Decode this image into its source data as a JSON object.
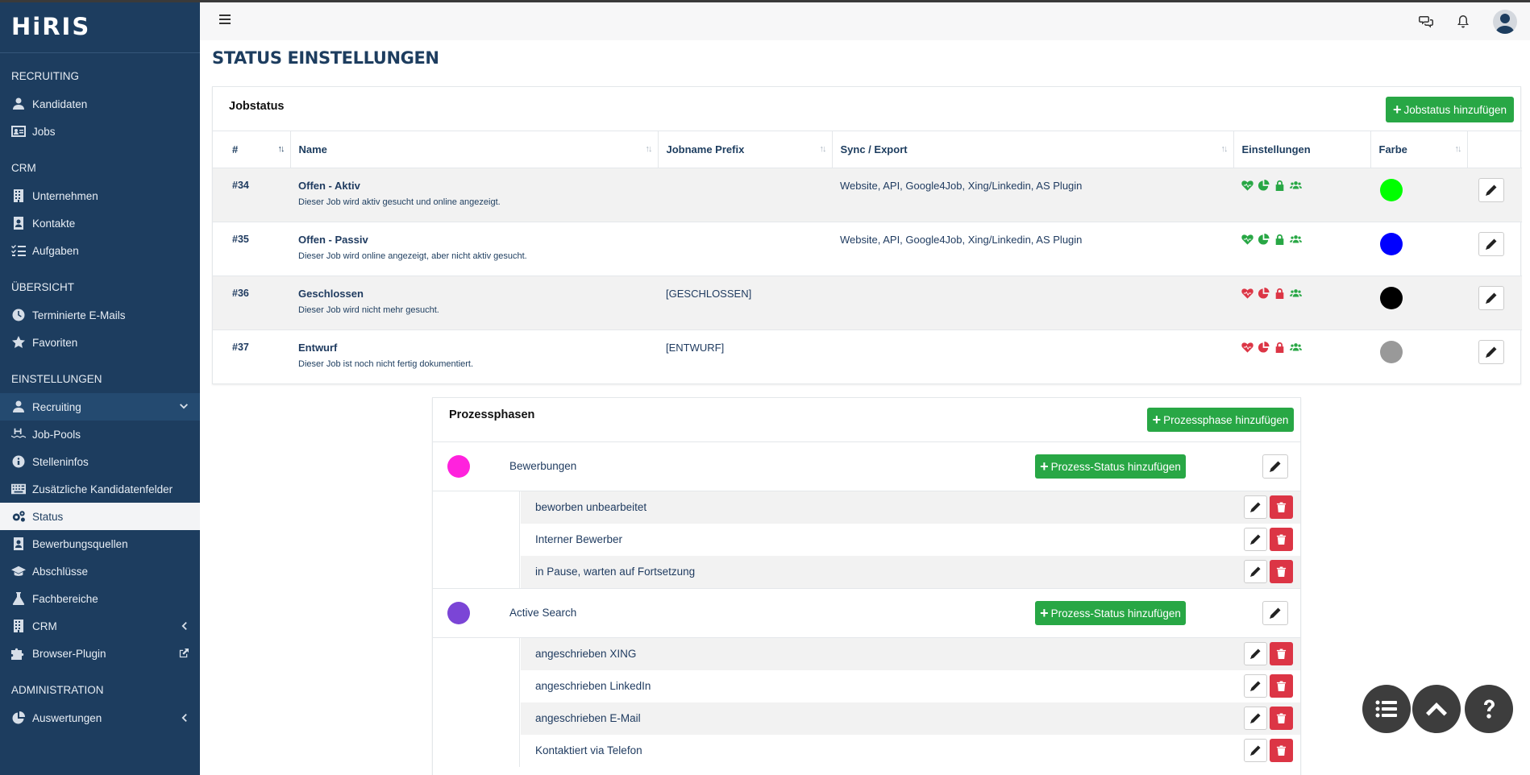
{
  "app": {
    "logo": "HiRIS"
  },
  "sidebar": {
    "sections": [
      {
        "title": "RECRUITING",
        "items": [
          {
            "label": "Kandidaten"
          },
          {
            "label": "Jobs"
          }
        ]
      },
      {
        "title": "CRM",
        "items": [
          {
            "label": "Unternehmen"
          },
          {
            "label": "Kontakte"
          },
          {
            "label": "Aufgaben"
          }
        ]
      },
      {
        "title": "ÜBERSICHT",
        "items": [
          {
            "label": "Terminierte E-Mails"
          },
          {
            "label": "Favoriten"
          }
        ]
      },
      {
        "title": "EINSTELLUNGEN",
        "items": [
          {
            "label": "Recruiting"
          },
          {
            "label": "Job-Pools"
          },
          {
            "label": "Stelleninfos"
          },
          {
            "label": "Zusätzliche Kandidatenfelder"
          },
          {
            "label": "Status"
          },
          {
            "label": "Bewerbungsquellen"
          },
          {
            "label": "Abschlüsse"
          },
          {
            "label": "Fachbereiche"
          },
          {
            "label": "CRM"
          },
          {
            "label": "Browser-Plugin"
          }
        ]
      },
      {
        "title": "ADMINISTRATION",
        "items": [
          {
            "label": "Auswertungen"
          }
        ]
      }
    ]
  },
  "page": {
    "title": "STATUS EINSTELLUNGEN"
  },
  "jobstatus": {
    "title": "Jobstatus",
    "add_label": "Jobstatus hinzufügen",
    "columns": [
      "#",
      "Name",
      "Jobname Prefix",
      "Sync / Export",
      "Einstellungen",
      "Farbe"
    ],
    "rows": [
      {
        "id": "#34",
        "name": "Offen - Aktiv",
        "desc": "Dieser Job wird aktiv gesucht und online angezeigt.",
        "prefix": "",
        "sync": "Website, API, Google4Job, Xing/Linkedin, AS Plugin",
        "color": "#00ff00",
        "setting_color": "#28a745"
      },
      {
        "id": "#35",
        "name": "Offen - Passiv",
        "desc": "Dieser Job wird online angezeigt, aber nicht aktiv gesucht.",
        "prefix": "",
        "sync": "Website, API, Google4Job, Xing/Linkedin, AS Plugin",
        "color": "#0000ff",
        "setting_color": "#28a745"
      },
      {
        "id": "#36",
        "name": "Geschlossen",
        "desc": "Dieser Job wird nicht mehr gesucht.",
        "prefix": "[GESCHLOSSEN]",
        "sync": "",
        "color": "#000000",
        "setting_color": "#dc3545"
      },
      {
        "id": "#37",
        "name": "Entwurf",
        "desc": "Dieser Job ist noch nicht fertig dokumentiert.",
        "prefix": "[ENTWURF]",
        "sync": "",
        "color": "#999999",
        "setting_color": "#dc3545"
      }
    ]
  },
  "prozess": {
    "title": "Prozessphasen",
    "add_label": "Prozessphase hinzufügen",
    "status_add_label": "Prozess-Status hinzufügen",
    "phases": [
      {
        "name": "Bewerbungen",
        "color": "#ff22dd",
        "statuses": [
          "beworben unbearbeitet",
          "Interner Bewerber",
          "in Pause, warten auf Fortsetzung"
        ]
      },
      {
        "name": "Active Search",
        "color": "#7b45d6",
        "statuses": [
          "angeschrieben XING",
          "angeschrieben LinkedIn",
          "angeschrieben E-Mail",
          "Kontaktiert via Telefon"
        ]
      }
    ]
  },
  "icons": {
    "header": [
      "menu-icon",
      "chat-icon",
      "bell-icon",
      "user-avatar-icon"
    ],
    "settings": [
      "heartbeat-icon",
      "pie-chart-icon",
      "lock-icon",
      "users-icon"
    ],
    "fab": [
      "list-icon",
      "chevron-up-icon",
      "question-icon"
    ]
  },
  "colors": {
    "sidebar": "#1d3d5f",
    "accent_green": "#28a745",
    "danger_red": "#dc3545"
  }
}
